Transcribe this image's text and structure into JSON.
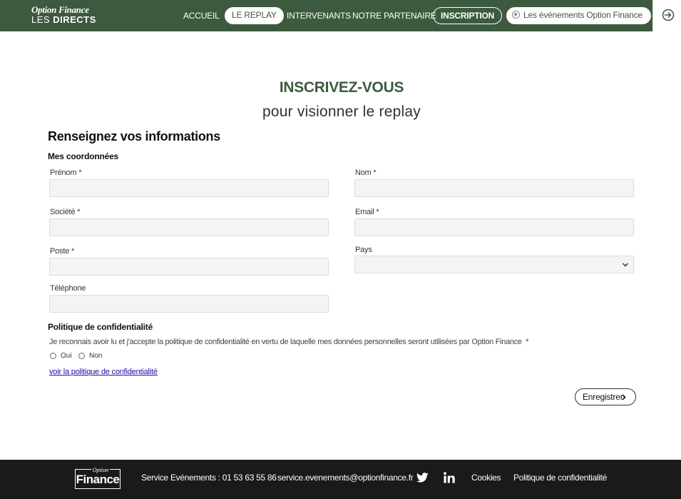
{
  "header": {
    "logo_line1": "Option Finance",
    "logo_line2_a": "LES ",
    "logo_line2_b": "DIRECTS",
    "nav": {
      "accueil": "ACCUEIL",
      "replay": "LE REPLAY",
      "intervenants": "INTERVENANTS",
      "partenaire": "NOTRE PARTENAIRE",
      "inscription": "INSCRIPTION",
      "events": "Les événements Option Finance"
    }
  },
  "page": {
    "title": "INSCRIVEZ-VOUS",
    "subtitle": "pour visionner le replay",
    "section_title": "Renseignez vos informations",
    "subsection": "Mes coordonnées"
  },
  "form": {
    "prenom": {
      "label": "Prénom",
      "req": "*",
      "value": ""
    },
    "nom": {
      "label": "Nom",
      "req": "*",
      "value": ""
    },
    "societe": {
      "label": "Société",
      "req": "*",
      "value": ""
    },
    "email": {
      "label": "Email",
      "req": "*",
      "value": ""
    },
    "poste": {
      "label": "Poste",
      "req": "*",
      "value": ""
    },
    "pays": {
      "label": "Pays",
      "value": ""
    },
    "telephone": {
      "label": "Téléphone",
      "value": ""
    }
  },
  "policy": {
    "title": "Politique de confidentialité",
    "text": "Je reconnais avoir lu et j'accepte la politique de confidentialité en vertu de laquelle mes données personnelles seront utilisées par Option Finance",
    "req": "*",
    "yes": "Oui",
    "no": "Non",
    "link": "voir la politique de confidentialité"
  },
  "submit_label": "Enregistrer",
  "footer": {
    "logo_small": "Option",
    "logo_big": "Finance",
    "service": "Service Evénements : 01 53 63 55 86",
    "email": "service.evenements@optionfinance.fr",
    "cookies": "Cookies",
    "privacy": "Politique de confidentialité"
  },
  "colors": {
    "brand_green": "#3d5a3e",
    "footer_bg": "#1a1a1a",
    "field_bg": "#f4f4f4",
    "link": "#1a0dab"
  },
  "icons": [
    "events-circle-icon",
    "login-arrow-icon",
    "chevron-down-icon",
    "chevron-right-icon",
    "twitter-icon",
    "linkedin-icon"
  ]
}
